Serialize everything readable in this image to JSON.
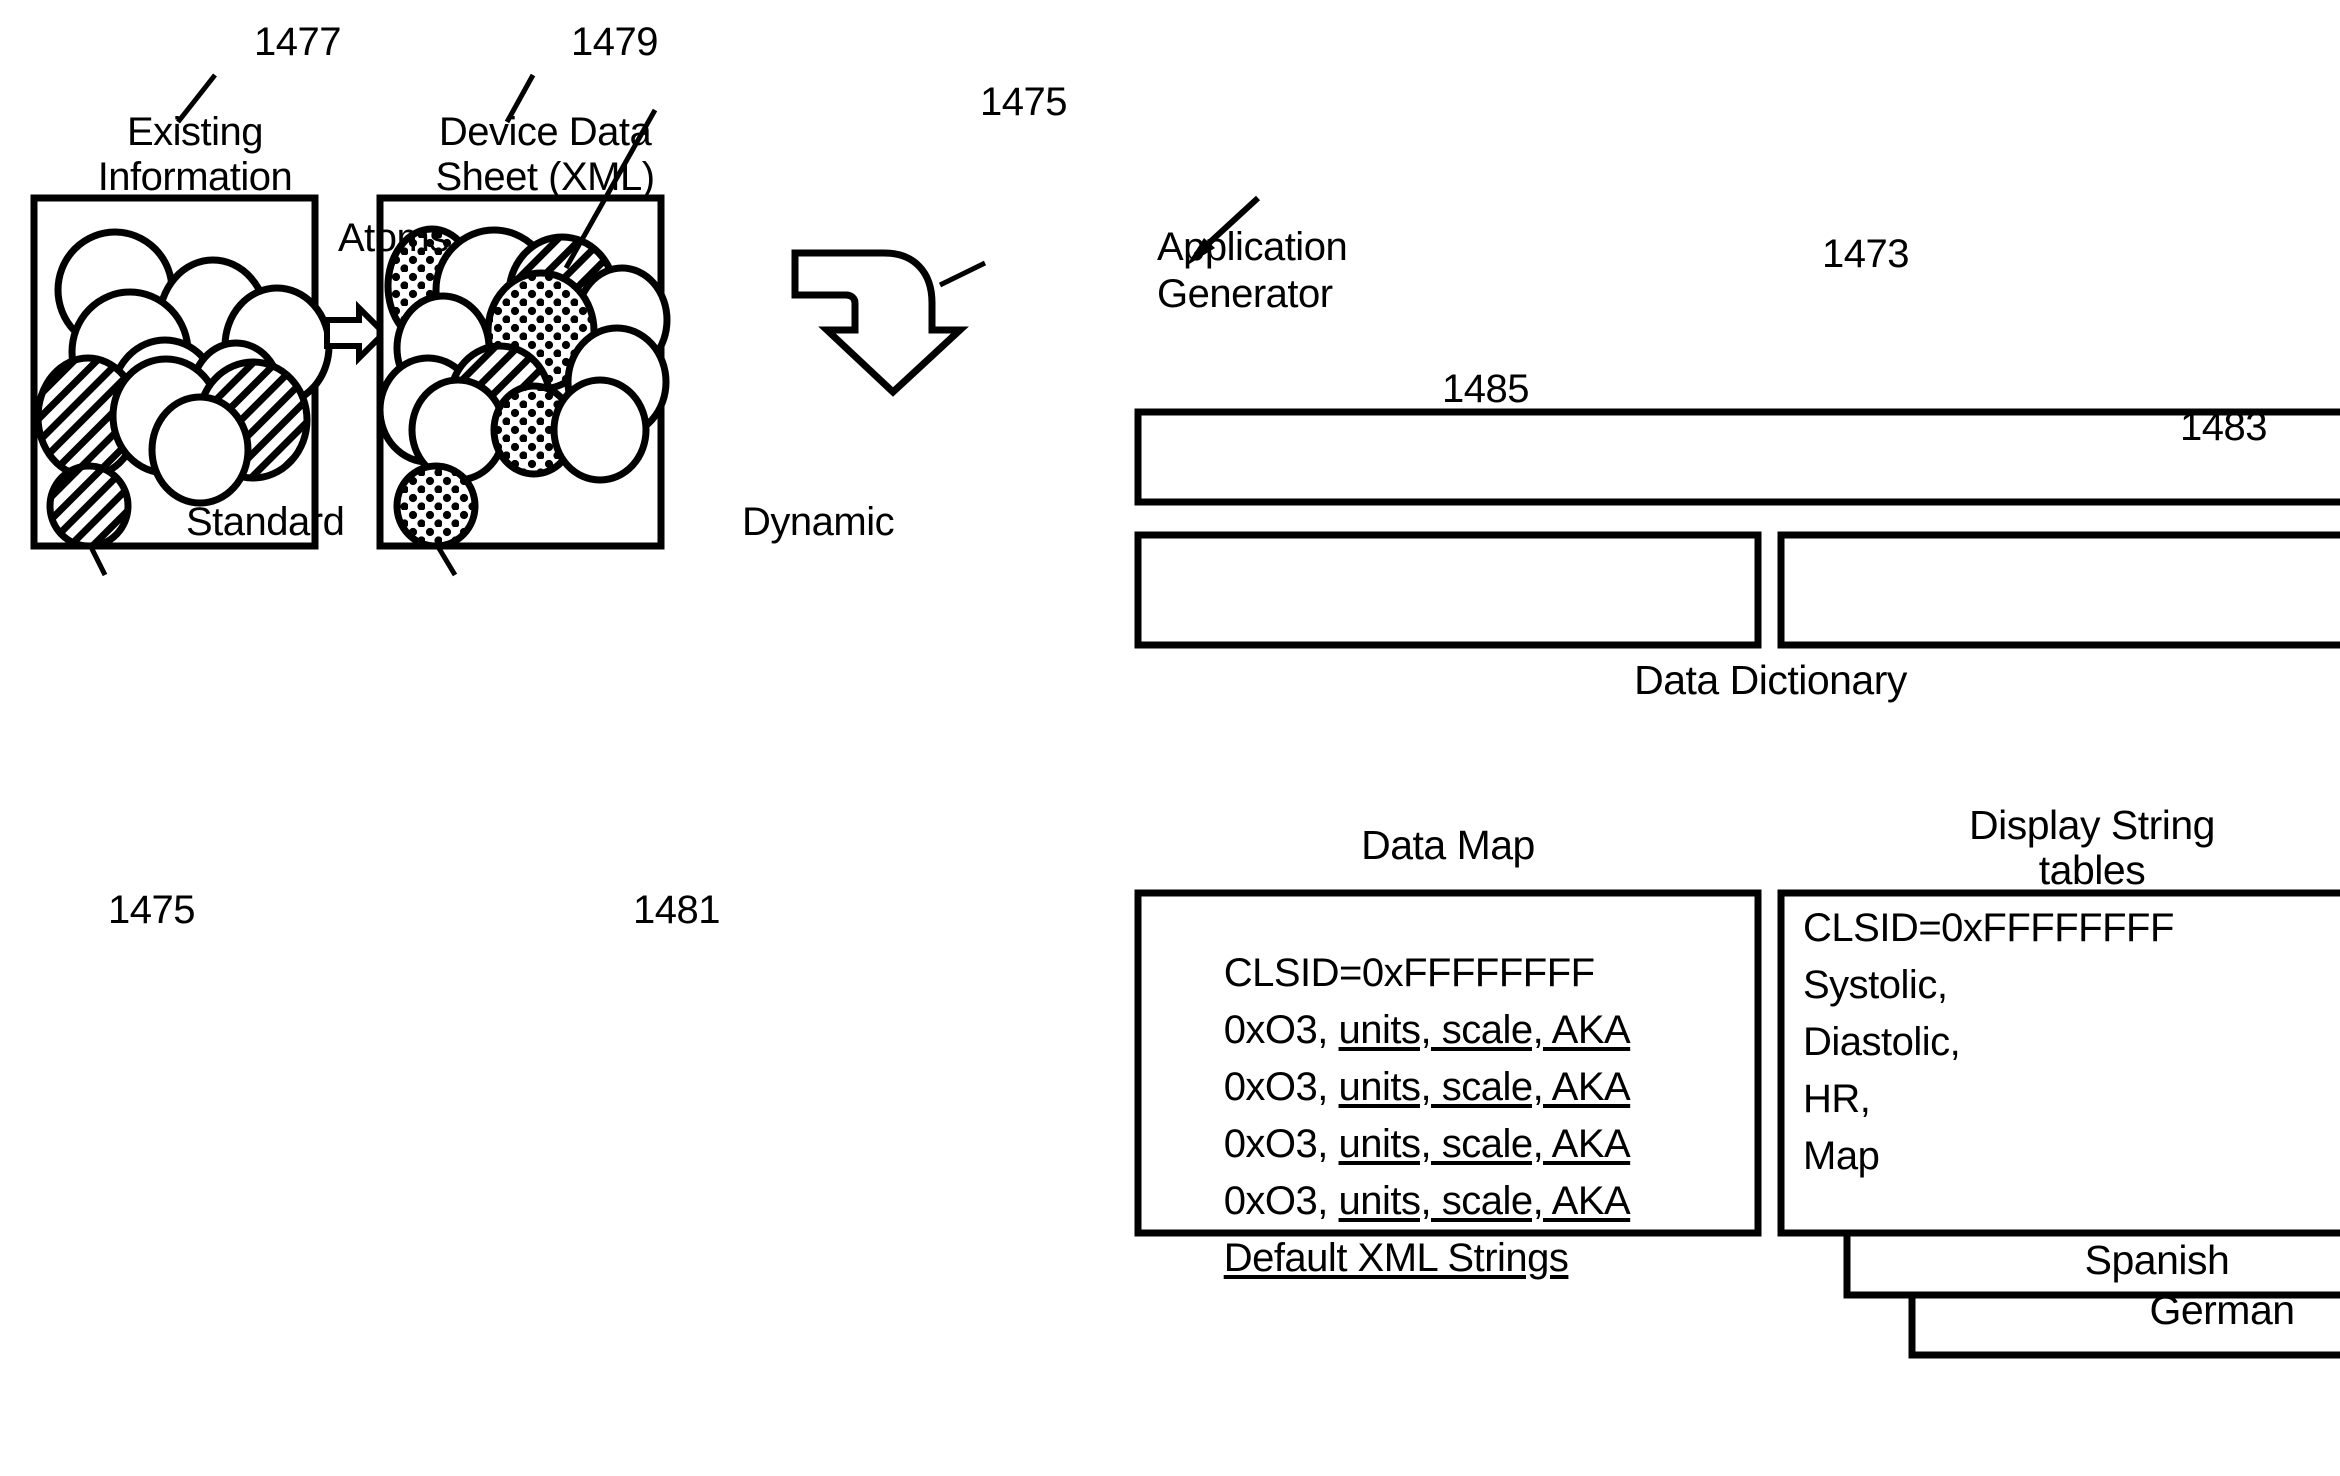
{
  "figure": {
    "type": "patent-diagram",
    "background": "#ffffff",
    "ink": "#000000"
  },
  "refs": {
    "existing_information": "1477",
    "device_data_sheet": "1479",
    "standard_atom_top": "1475",
    "standard_atom_bottom": "1475",
    "dynamic_atom": "1481",
    "data_dictionary_group": "1473",
    "data_dictionary_box": "1483",
    "application_generator_arrow": "1485"
  },
  "left_panel": {
    "caption_line1": "Existing",
    "caption_line2": "Information",
    "inner_label": "Atoms",
    "legend_label": "Standard"
  },
  "middle_panel": {
    "caption_line1": "Device Data",
    "caption_line2": "Sheet (XML)",
    "legend_label": "Dynamic"
  },
  "application_generator": {
    "line1": "Application",
    "line2": "Generator"
  },
  "dictionary": {
    "title": "Data Dictionary",
    "left_box_title": "Data Map",
    "right_box_title_line1": "Display String",
    "right_box_title_line2": "tables"
  },
  "data_map_lines": [
    {
      "plain": "CLSID=0xFFFFFFFF",
      "underlined": ""
    },
    {
      "plain": "0xO3, ",
      "underlined": "units, scale, AKA"
    },
    {
      "plain": "0xO3, ",
      "underlined": "units, scale, AKA"
    },
    {
      "plain": "0xO3, ",
      "underlined": "units, scale, AKA"
    },
    {
      "plain": "0xO3, ",
      "underlined": "units, scale, AKA"
    },
    {
      "plain": "",
      "underlined": "Default XML Strings"
    }
  ],
  "display_string_lines": [
    "CLSID=0xFFFFFFFF",
    "Systolic,",
    "Diastolic,",
    "HR,",
    "Map"
  ],
  "language_cards": [
    "Spanish",
    "German"
  ]
}
